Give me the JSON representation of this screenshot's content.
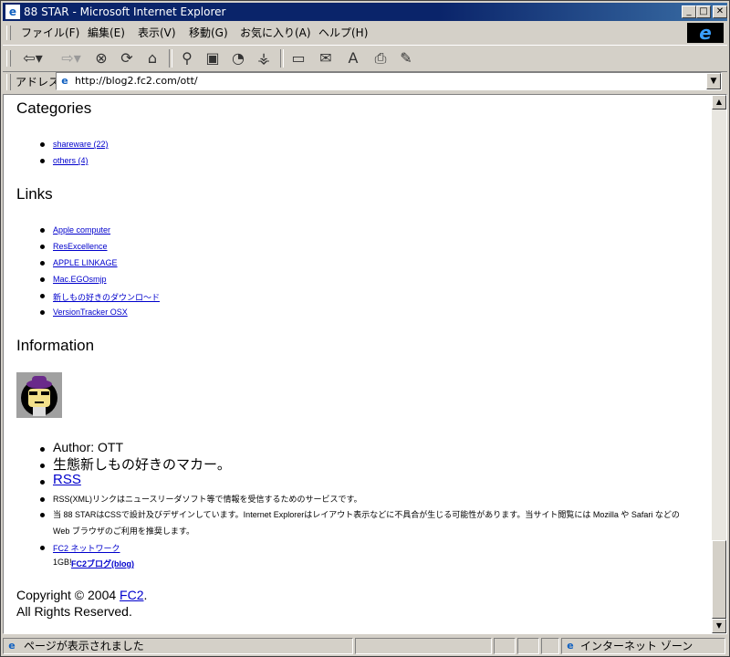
{
  "window": {
    "title": "88 STAR - Microsoft Internet Explorer",
    "app_icon": "ie-logo-icon",
    "minimize": "_",
    "maximize": "□",
    "close": "✕"
  },
  "menubar": {
    "items": [
      "ファイル(F)",
      "編集(E)",
      "表示(V)",
      "移動(G)",
      "お気に入り(A)",
      "ヘルプ(H)"
    ]
  },
  "toolbar": {
    "icons": [
      "back-icon",
      "forward-icon",
      "stop-icon",
      "refresh-icon",
      "home-icon",
      "search-icon",
      "favorites-icon",
      "history-icon",
      "channels-icon",
      "fullscreen-icon",
      "mail-icon",
      "font-icon",
      "print-icon",
      "edit-icon"
    ]
  },
  "address": {
    "label": "アドレス",
    "url": "http://blog2.fc2.com/ott/"
  },
  "page": {
    "categories": {
      "heading": "Categories",
      "items": [
        "shareware (22)",
        "others (4)"
      ]
    },
    "links": {
      "heading": "Links",
      "items": [
        "Apple computer",
        "ResExcellence",
        "APPLE LINKAGE",
        "Mac.EGOsmjp",
        "新しもの好きのダウンロ～ド",
        "VersionTracker OSX"
      ]
    },
    "information": {
      "heading": "Information",
      "author": "Author: OTT",
      "tagline": "生態新しもの好きのマカー。",
      "rss_link": "RSS",
      "rss_desc": "RSS(XML)リンクはニュースリーダソフト等で情報を受信するためのサービスです。",
      "notice_line1": "当 88 STARはCSSで設計及びデザインしています。Internet Explorerはレイアウト表示などに不具合が生じる可能性があります。当サイト閲覧には Mozilla や Safari などの",
      "notice_line2": "Web ブラウザのご利用を推奨します。",
      "network_link": "FC2 ネットワーク",
      "network_prefix": "1GB!",
      "network_blog": "FC2ブログ(blog)"
    },
    "copyright_prefix": "Copyright © 2004 ",
    "copyright_link": "FC2",
    "copyright_suffix": ".",
    "rights": "All Rights Reserved."
  },
  "status": {
    "text": "ページが表示されました",
    "zone": "インターネット ゾーン"
  }
}
